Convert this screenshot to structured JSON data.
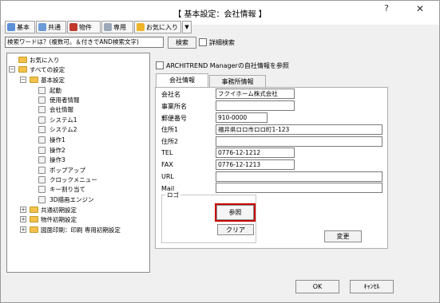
{
  "window": {
    "title": "【 基本設定：会社情報 】",
    "help_label": "?",
    "close_label": "✕"
  },
  "toolbar": {
    "buttons": [
      {
        "label": "基本",
        "icon": "home-icon",
        "color": "#5b8fd6"
      },
      {
        "label": "共通",
        "icon": "share-icon",
        "color": "#6a9bd8"
      },
      {
        "label": "物件",
        "icon": "house-icon",
        "color": "#c0392b"
      },
      {
        "label": "専用",
        "icon": "user-icon",
        "color": "#9aa8b8"
      },
      {
        "label": "お気に入り",
        "icon": "favorite-folder-icon",
        "color": "#f0b429"
      }
    ],
    "dropdown_label": "▼"
  },
  "search": {
    "value": "検索ワードは？(複数可。＆付きでAND検索文字)",
    "button_label": "検索",
    "detail_label": "詳細検索"
  },
  "tree": {
    "items": [
      {
        "label": "お気に入り",
        "type": "folder",
        "expander": ""
      },
      {
        "label": "すべての設定",
        "type": "folder",
        "expander": "−"
      },
      {
        "label": "基本設定",
        "type": "folder",
        "expander": "−"
      },
      {
        "label": "起動",
        "type": "page"
      },
      {
        "label": "使用者情報",
        "type": "page"
      },
      {
        "label": "会社情報",
        "type": "page"
      },
      {
        "label": "システム1",
        "type": "page"
      },
      {
        "label": "システム2",
        "type": "page"
      },
      {
        "label": "操作1",
        "type": "page"
      },
      {
        "label": "操作2",
        "type": "page"
      },
      {
        "label": "操作3",
        "type": "page"
      },
      {
        "label": "ポップアップ",
        "type": "page"
      },
      {
        "label": "クロックメニュー",
        "type": "page"
      },
      {
        "label": "キー割り当て",
        "type": "page"
      },
      {
        "label": "3D描画エンジン",
        "type": "page"
      },
      {
        "label": "共通初期設定",
        "type": "folder",
        "expander": "+"
      },
      {
        "label": "物件初期設定",
        "type": "folder",
        "expander": "+"
      },
      {
        "label": "図面印刷：印刷 専用初期設定",
        "type": "folder",
        "expander": "+"
      }
    ]
  },
  "reference_checkbox_label": "ARCHITREND Managerの自社情報を参照",
  "tabs": [
    {
      "label": "会社情報",
      "active": true
    },
    {
      "label": "事務所情報",
      "active": false
    }
  ],
  "form": {
    "fields": [
      {
        "label": "会社名",
        "value": "フクイホーム株式会社"
      },
      {
        "label": "事業所名",
        "value": ""
      },
      {
        "label": "郵便番号",
        "value": "910-0000"
      },
      {
        "label": "住所1",
        "value": "福井県ロロ市ロロ町1-123"
      },
      {
        "label": "住所2",
        "value": ""
      },
      {
        "label": "TEL",
        "value": "0776-12-1212"
      },
      {
        "label": "FAX",
        "value": "0776-12-1213"
      },
      {
        "label": "URL",
        "value": ""
      },
      {
        "label": "Mail",
        "value": ""
      }
    ],
    "logo_group_label": "ロゴ",
    "browse_label": "参照",
    "clear_label": "クリア",
    "change_label": "変更"
  },
  "footer": {
    "ok_label": "OK",
    "cancel_label": "ｷｬﾝｾﾙ"
  },
  "colors": {
    "focus_outline": "#c80000",
    "folder": "#f2c24b"
  }
}
